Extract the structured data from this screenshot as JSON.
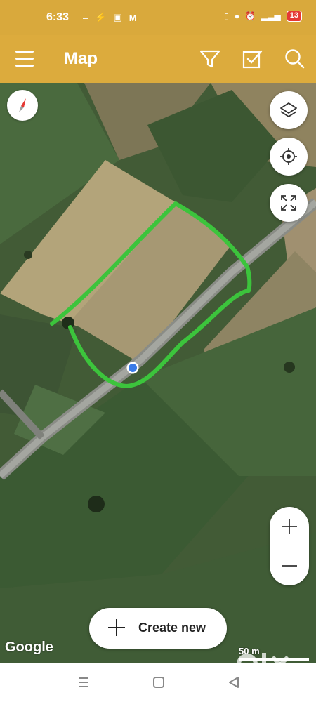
{
  "status_bar": {
    "time": "6:33",
    "battery": "13"
  },
  "app_bar": {
    "title": "Map"
  },
  "map": {
    "attribution": "Google",
    "scale_label": "50 m",
    "watermark": "olx"
  },
  "actions": {
    "create_new_label": "Create new"
  },
  "colors": {
    "accent": "#dcab3d",
    "drawn_outline": "#3cc43c",
    "location_dot": "#3a7be8"
  }
}
